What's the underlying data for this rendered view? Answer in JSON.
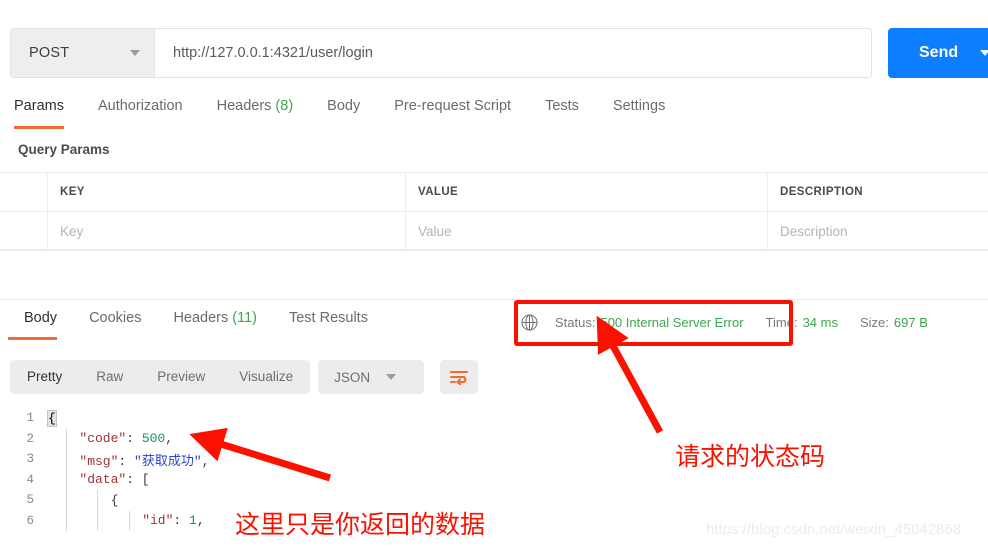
{
  "request": {
    "method": "POST",
    "url": "http://127.0.0.1:4321/user/login",
    "send_label": "Send",
    "tabs": [
      {
        "label": "Params",
        "count": ""
      },
      {
        "label": "Authorization",
        "count": ""
      },
      {
        "label": "Headers",
        "count": "(8)"
      },
      {
        "label": "Body",
        "count": ""
      },
      {
        "label": "Pre-request Script",
        "count": ""
      },
      {
        "label": "Tests",
        "count": ""
      },
      {
        "label": "Settings",
        "count": ""
      }
    ],
    "section_title": "Query Params",
    "table": {
      "headers": [
        "KEY",
        "VALUE",
        "DESCRIPTION"
      ],
      "placeholder_row": [
        "Key",
        "Value",
        "Description"
      ]
    }
  },
  "response": {
    "tabs": [
      {
        "label": "Body",
        "count": ""
      },
      {
        "label": "Cookies",
        "count": ""
      },
      {
        "label": "Headers",
        "count": "(11)"
      },
      {
        "label": "Test Results",
        "count": ""
      }
    ],
    "meta": {
      "status_label": "Status:",
      "status_value": "500 Internal Server Error",
      "time_label": "Time:",
      "time_value": "34 ms",
      "size_label": "Size:",
      "size_value": "697 B",
      "globe_icon": "globe-icon"
    },
    "viewer": {
      "modes": [
        "Pretty",
        "Raw",
        "Preview",
        "Visualize"
      ],
      "active_mode": "Pretty",
      "format": "JSON",
      "wrap_icon": "word-wrap-icon"
    },
    "body_lines": [
      {
        "n": "1",
        "indent": 0,
        "tokens": [
          {
            "t": "{",
            "c": "brace-hl"
          }
        ]
      },
      {
        "n": "2",
        "indent": 1,
        "tokens": [
          {
            "t": "\"code\"",
            "c": "k"
          },
          {
            "t": ": ",
            "c": "punct"
          },
          {
            "t": "500",
            "c": "num"
          },
          {
            "t": ",",
            "c": "punct"
          }
        ]
      },
      {
        "n": "3",
        "indent": 1,
        "tokens": [
          {
            "t": "\"msg\"",
            "c": "k"
          },
          {
            "t": ": ",
            "c": "punct"
          },
          {
            "t": "\"获取成功\"",
            "c": "str"
          },
          {
            "t": ",",
            "c": "punct"
          }
        ]
      },
      {
        "n": "4",
        "indent": 1,
        "tokens": [
          {
            "t": "\"data\"",
            "c": "k"
          },
          {
            "t": ": [",
            "c": "punct"
          }
        ]
      },
      {
        "n": "5",
        "indent": 2,
        "tokens": [
          {
            "t": "{",
            "c": "punct"
          }
        ]
      },
      {
        "n": "6",
        "indent": 3,
        "tokens": [
          {
            "t": "\"id\"",
            "c": "k"
          },
          {
            "t": ": ",
            "c": "punct"
          },
          {
            "t": "1",
            "c": "num"
          },
          {
            "t": ",",
            "c": "punct"
          }
        ]
      }
    ]
  },
  "annotations": {
    "status_note": "请求的状态码",
    "data_note": "这里只是你返回的数据",
    "box_color": "#fb1100",
    "arrow_color": "#fb1100"
  },
  "watermark": "https://blog.csdn.net/weixin_45042868"
}
